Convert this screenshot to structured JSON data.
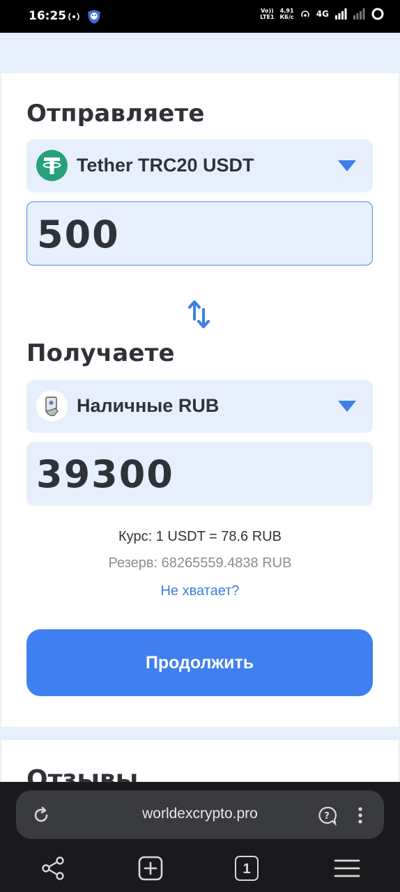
{
  "status": {
    "time": "16:25",
    "net_top": "Vo))",
    "net_bottom": "LTE1",
    "speed_top": "4,91",
    "speed_bottom": "КБ/с",
    "network": "4G"
  },
  "send": {
    "title": "Отправляете",
    "currency": "Tether TRC20 USDT",
    "currency_icon": "tether-icon",
    "amount": "500"
  },
  "receive": {
    "title": "Получаете",
    "currency": "Наличные RUB",
    "currency_icon": "cash-icon",
    "amount": "39300"
  },
  "rate": "Курс: 1 USDT = 78.6 RUB",
  "reserve": "Резерв: 68265559.4838 RUB",
  "not_enough_link": "Не хватает?",
  "continue_label": "Продолжить",
  "reviews_title": "Отзывы",
  "browser": {
    "url": "worldexcrypto.pro",
    "tab_count": "1"
  },
  "colors": {
    "accent": "#3f7ff0",
    "tether": "#26a17b",
    "field_bg": "#e8effc",
    "link": "#3a7ee2"
  }
}
